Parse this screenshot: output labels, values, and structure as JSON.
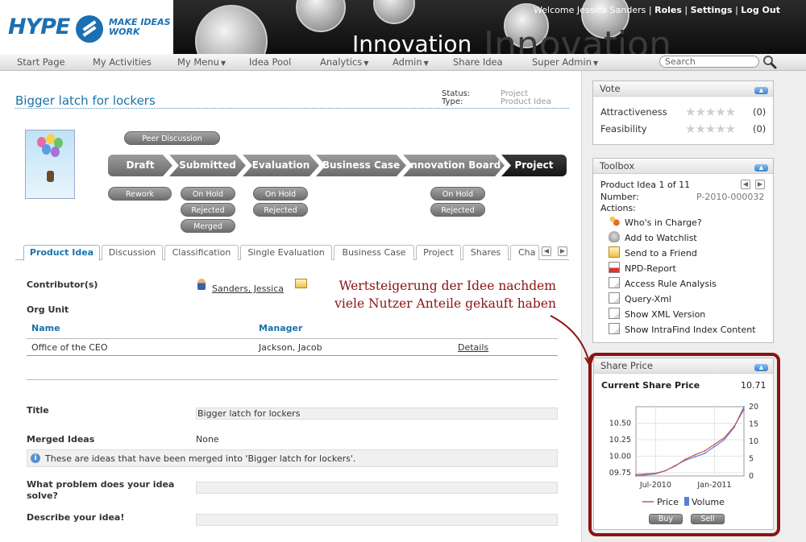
{
  "header": {
    "logo_text": "HYPE",
    "logo_tagline": [
      "MAKE IDEAS",
      "WORK"
    ],
    "banner_title": "Innovation",
    "welcome": "Welcome",
    "user_name": "Jessica Sanders",
    "links": [
      "Roles",
      "Settings",
      "Log Out"
    ],
    "separator": "|"
  },
  "nav": {
    "items": [
      "Start Page",
      "My Activities",
      "My Menu",
      "Idea Pool",
      "Analytics",
      "Admin",
      "Share Idea",
      "Super Admin"
    ],
    "dropdown_items": [
      "My Menu",
      "Analytics",
      "Admin",
      "Super Admin"
    ],
    "search_placeholder": "Search"
  },
  "idea": {
    "title": "Bigger latch for lockers",
    "status_label": "Status:",
    "type_label": "Type:",
    "status_value": "Project",
    "type_value": "Product Idea"
  },
  "workflow": {
    "peer_discussion": "Peer Discussion",
    "stages": [
      "Draft",
      "Submitted",
      "Evaluation",
      "Business Case",
      "Innovation Board",
      "Project"
    ],
    "current_stage": "Project",
    "pills": {
      "rework": "Rework",
      "onhold_1": "On Hold",
      "rejected_1": "Rejected",
      "merged": "Merged",
      "onhold_2": "On Hold",
      "rejected_2": "Rejected",
      "onhold_3": "On Hold",
      "rejected_3": "Rejected"
    }
  },
  "tabs": {
    "items": [
      "Product Idea",
      "Discussion",
      "Classification",
      "Single Evaluation",
      "Business Case",
      "Project",
      "Shares",
      "Cha"
    ],
    "active": "Product Idea"
  },
  "details": {
    "contributors_label": "Contributor(s)",
    "contributor": "Sanders, Jessica",
    "org_unit_label": "Org Unit",
    "org_table": {
      "headers": [
        "Name",
        "Manager"
      ],
      "rows": [
        [
          "Office of the CEO",
          "Jackson, Jacob",
          "Details"
        ]
      ]
    },
    "title_label": "Title",
    "title_value": "Bigger latch for lockers",
    "merged_label": "Merged Ideas",
    "merged_value": "None",
    "merged_info": "These are ideas that have been merged into 'Bigger latch for lockers'.",
    "problem_label_1": "What problem does your idea",
    "problem_label_2": "solve?",
    "describe_label": "Describe your idea!"
  },
  "annotation": {
    "line1": "Wertsteigerung der Idee nachdem",
    "line2": "viele Nutzer Anteile gekauft haben"
  },
  "vote": {
    "title": "Vote",
    "rows": [
      {
        "label": "Attractiveness",
        "count": "(0)",
        "stars": 0
      },
      {
        "label": "Feasibility",
        "count": "(0)",
        "stars": 0
      }
    ]
  },
  "toolbox": {
    "title": "Toolbox",
    "position": "Product Idea 1 of 11",
    "number_label": "Number:",
    "number_value": "P-2010-000032",
    "actions_label": "Actions:",
    "actions": [
      {
        "label": "Who's in Charge?",
        "icon": "people-icon"
      },
      {
        "label": "Add to Watchlist",
        "icon": "heart-icon"
      },
      {
        "label": "Send to a Friend",
        "icon": "mail-icon"
      },
      {
        "label": "NPD-Report",
        "icon": "pdf-icon"
      },
      {
        "label": "Access Rule Analysis",
        "icon": "page-icon"
      },
      {
        "label": "Query-Xml",
        "icon": "page-icon"
      },
      {
        "label": "Show XML Version",
        "icon": "page-icon"
      },
      {
        "label": "Show IntraFind Index Content",
        "icon": "page-icon"
      }
    ]
  },
  "share_price": {
    "title": "Share Price",
    "current_label": "Current Share Price",
    "current_value": "10.71",
    "buy": "Buy",
    "sell": "Sell"
  },
  "chart_data": {
    "type": "line",
    "series": [
      {
        "name": "Price",
        "color": "#c85050",
        "y_axis": "left",
        "x": [
          "2010-05",
          "2010-06",
          "2010-07",
          "2010-08",
          "2010-09",
          "2010-10",
          "2010-11",
          "2010-12",
          "2011-01",
          "2011-02",
          "2011-03",
          "2011-04"
        ],
        "values": [
          9.72,
          9.73,
          9.74,
          9.78,
          9.85,
          9.95,
          10.02,
          10.08,
          10.18,
          10.28,
          10.45,
          10.71
        ]
      },
      {
        "name": "Volume",
        "color": "#5b7fd6",
        "y_axis": "right",
        "x": [
          "2010-05",
          "2010-06",
          "2010-07",
          "2010-08",
          "2010-09",
          "2010-10",
          "2010-11",
          "2010-12",
          "2011-01",
          "2011-02",
          "2011-03",
          "2011-04"
        ],
        "values": [
          0,
          0.3,
          0.6,
          1.5,
          3,
          4.5,
          5.5,
          6.5,
          8.5,
          10.5,
          14,
          20
        ]
      }
    ],
    "x_ticks": [
      "Jul-2010",
      "Jan-2011"
    ],
    "x_tick_dates": [
      "2010-07",
      "2011-01"
    ],
    "y_left_ticks": [
      "09.75",
      "10.00",
      "10.25",
      "10.50"
    ],
    "y_left_range": [
      9.7,
      10.75
    ],
    "y_right_ticks": [
      "0",
      "5",
      "10",
      "15",
      "20"
    ],
    "y_right_range": [
      0,
      20
    ],
    "grid": true,
    "legend": "bottom"
  }
}
